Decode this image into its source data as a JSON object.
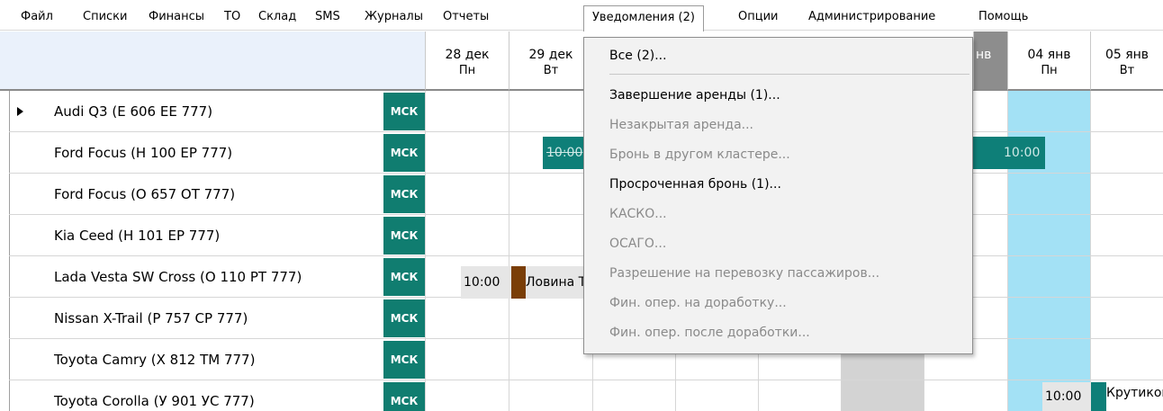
{
  "menubar": {
    "items": [
      "Файл",
      "Списки",
      "Финансы",
      "ТО",
      "Склад",
      "SMS",
      "Журналы",
      "Отчеты",
      "Уведомления (2)",
      "Опции",
      "Администрирование",
      "Помощь"
    ]
  },
  "calendar": {
    "dates": [
      {
        "date": "28 дек",
        "dow": "Пн"
      },
      {
        "date": "29 дек",
        "dow": "Вт"
      },
      {
        "date": "нв",
        "dow": ""
      },
      {
        "date": "04 янв",
        "dow": "Пн"
      },
      {
        "date": "05 янв",
        "dow": "Вт"
      }
    ]
  },
  "vehicles": [
    {
      "name": "Audi Q3 (Е 606 ЕЕ 777)",
      "tag": "МСК"
    },
    {
      "name": "Ford Focus (Н 100 ЕР 777)",
      "tag": "МСК"
    },
    {
      "name": "Ford Focus (О 657 ОТ 777)",
      "tag": "МСК"
    },
    {
      "name": "Kia Ceed (Н 101 ЕР 777)",
      "tag": "МСК"
    },
    {
      "name": "Lada Vesta SW Cross (О 110 РТ 777)",
      "tag": "МСК"
    },
    {
      "name": "Nissan X-Trail (Р 757 СР 777)",
      "tag": "МСК"
    },
    {
      "name": "Toyota Camry (Х 812 ТМ 777)",
      "tag": "МСК"
    },
    {
      "name": "Toyota Corolla (У 901 УС 777)",
      "tag": "МСК"
    }
  ],
  "bookings": {
    "ford_focus_start": "10:00",
    "ford_focus_end": "10:00",
    "lada_time": "10:00",
    "lada_client": "Ловина Т",
    "corolla_time": "10:00",
    "corolla_client": "Крутиков"
  },
  "dropdown": {
    "all": "Все (2)...",
    "items": [
      {
        "label": "Завершение аренды (1)...",
        "enabled": true
      },
      {
        "label": "Незакрытая аренда...",
        "enabled": false
      },
      {
        "label": "Бронь в другом кластере...",
        "enabled": false
      },
      {
        "label": "Просроченная бронь (1)...",
        "enabled": true
      },
      {
        "label": "КАСКО...",
        "enabled": false
      },
      {
        "label": "ОСАГО...",
        "enabled": false
      },
      {
        "label": "Разрешение на перевозку пассажиров...",
        "enabled": false
      },
      {
        "label": "Фин. опер. на доработку...",
        "enabled": false
      },
      {
        "label": "Фин. опер. после доработки...",
        "enabled": false
      }
    ]
  },
  "colors": {
    "tag": "#107d70",
    "booking_teal": "#0e7f78",
    "today_column": "#a3e1f5",
    "brown": "#7a3e07"
  }
}
